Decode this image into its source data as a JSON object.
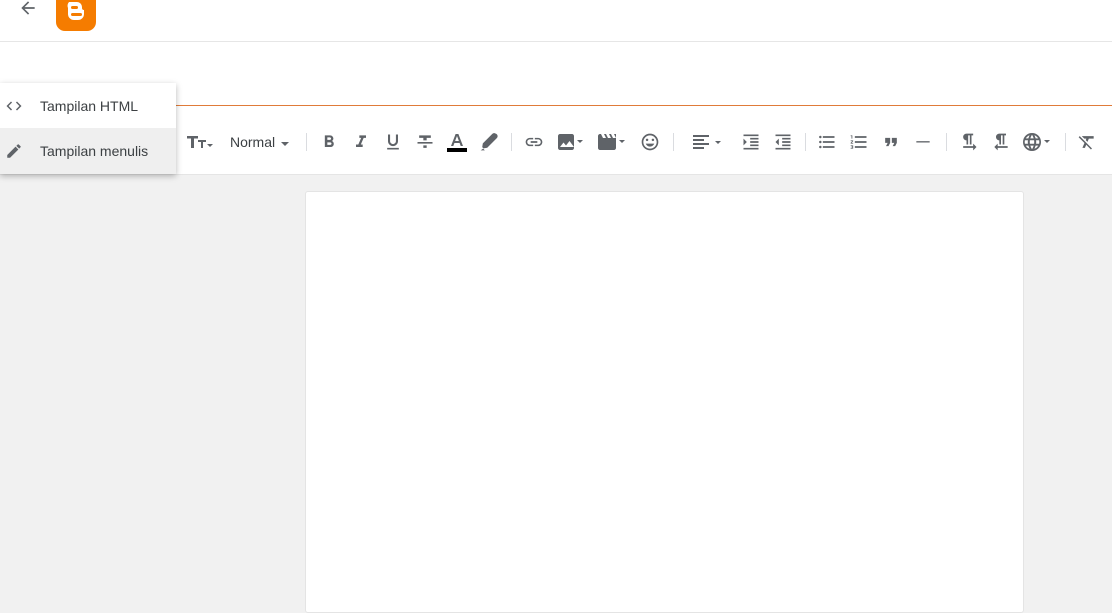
{
  "header": {
    "back_icon": "arrow-back-icon",
    "logo": "blogger-logo"
  },
  "view_menu": {
    "items": [
      {
        "label": "Tampilan HTML",
        "icon": "code-icon",
        "selected": false
      },
      {
        "label": "Tampilan menulis",
        "icon": "pencil-icon",
        "selected": true
      }
    ]
  },
  "toolbar": {
    "paragraph_style": "Normal",
    "icons": [
      "font-size-icon",
      "bold-icon",
      "italic-icon",
      "underline-icon",
      "strikethrough-icon",
      "text-color-icon",
      "highlight-icon",
      "link-icon",
      "image-icon",
      "video-icon",
      "emoji-icon",
      "align-icon",
      "indent-icon",
      "outdent-icon",
      "bulleted-list-icon",
      "numbered-list-icon",
      "quote-icon",
      "horizontal-rule-icon",
      "ltr-icon",
      "rtl-icon",
      "language-icon",
      "clear-formatting-icon"
    ]
  },
  "colors": {
    "brand_orange": "#f57c00",
    "title_underline": "#e07b39",
    "icon_gray": "#5f6368"
  }
}
